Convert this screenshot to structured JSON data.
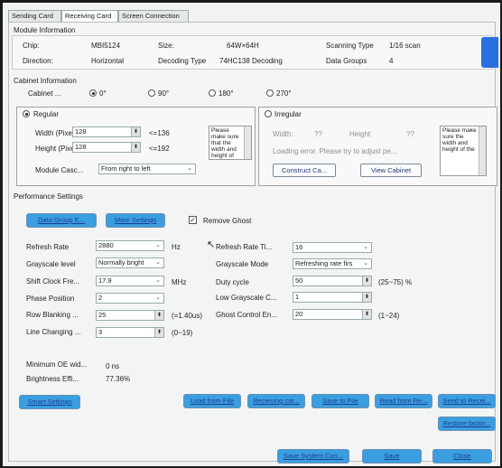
{
  "tabs": [
    "Sending Card",
    "Receiving Card",
    "Screen Connection"
  ],
  "module_info": {
    "title": "Module Information",
    "chip_label": "Chip:",
    "chip_value": "MBI5124",
    "size_label": "Size:",
    "size_value": "64W×64H",
    "scan_type_label": "Scanning Type",
    "scan_type_value": "1/16 scan",
    "direction_label": "Direction:",
    "direction_value": "Horizontal",
    "decoding_label": "Decoding Type",
    "decoding_value": "74HC138 Decoding",
    "data_groups_label": "Data Groups",
    "data_groups_value": "4"
  },
  "cabinet": {
    "title": "Cabinet Information",
    "cabinet_label": "Cabinet ...",
    "rotations": [
      "0°",
      "90°",
      "180°",
      "270°"
    ],
    "selected_rotation": "0°",
    "regular_label": "Regular",
    "irregular_label": "Irregular",
    "width_label": "Width (Pixel)",
    "width_value": "128",
    "width_max": "<=136",
    "height_label": "Height (Pixel)",
    "height_value": "128",
    "height_max": "<=192",
    "regular_note": "Please make sure that the width and height of",
    "module_cascade_label": "Module Casc...",
    "module_cascade_value": "From right to left",
    "irr_width_label": "Width:",
    "irr_width_value": "??",
    "irr_height_label": "Height",
    "irr_height_value": "??",
    "irr_error": "Loading error. Please try to adjust pe...",
    "irr_note": "Please make sure the width and height of the",
    "construct_button": "Construct Ca...",
    "view_cabinet_button": "View Cabinet"
  },
  "performance": {
    "title": "Performance Settings",
    "data_group_button": "Data Group E...",
    "more_settings_button": "More Settings",
    "remove_ghost_label": "Remove Ghost",
    "remove_ghost_checked": true,
    "refresh_rate_label": "Refresh Rate",
    "refresh_rate_value": "2880",
    "refresh_rate_unit": "Hz",
    "refresh_times_label": "Refresh Rate Ti...",
    "refresh_times_value": "16",
    "grayscale_level_label": "Grayscale level",
    "grayscale_level_value": "Normally bright",
    "grayscale_mode_label": "Grayscale Mode",
    "grayscale_mode_value": "Refreshing rate firs",
    "shift_clock_label": "Shift Clock Fre...",
    "shift_clock_value": "17.9",
    "shift_clock_unit": "MHz",
    "duty_cycle_label": "Duty cycle",
    "duty_cycle_value": "50",
    "duty_cycle_range": "(25~75) %",
    "phase_label": "Phase Position",
    "phase_value": "2",
    "low_gray_label": "Low Grayscale C...",
    "low_gray_value": "1",
    "row_blanking_label": "Row Blanking ...",
    "row_blanking_value": "25",
    "row_blanking_range": "(=1.40us)",
    "ghost_control_label": "Ghost Control En...",
    "ghost_control_value": "20",
    "ghost_control_range": "(1~24)",
    "line_changing_label": "Line Changing ...",
    "line_changing_value": "3",
    "line_changing_range": "(0~19)",
    "min_oe_label": "Minimum OE wid...",
    "min_oe_value": "0 ns",
    "brightness_label": "Brightness Effi...",
    "brightness_value": "77.36%"
  },
  "bottom": {
    "smart_settings": "Smart Settings",
    "load_from_file": "Load from File",
    "receiving_card": "Receiving car...",
    "save_to_file": "Save to File",
    "read_from": "Read from Re...",
    "send_to_receiver": "Send to Recei...",
    "restore_factory": "Restore factor...",
    "save_system": "Save System Con...",
    "save": "Save",
    "close": "Close"
  },
  "colors": {
    "accent_button": "#3a9ee0",
    "button_text": "#1b3f8c",
    "window_bg": "#f1f3f2"
  }
}
